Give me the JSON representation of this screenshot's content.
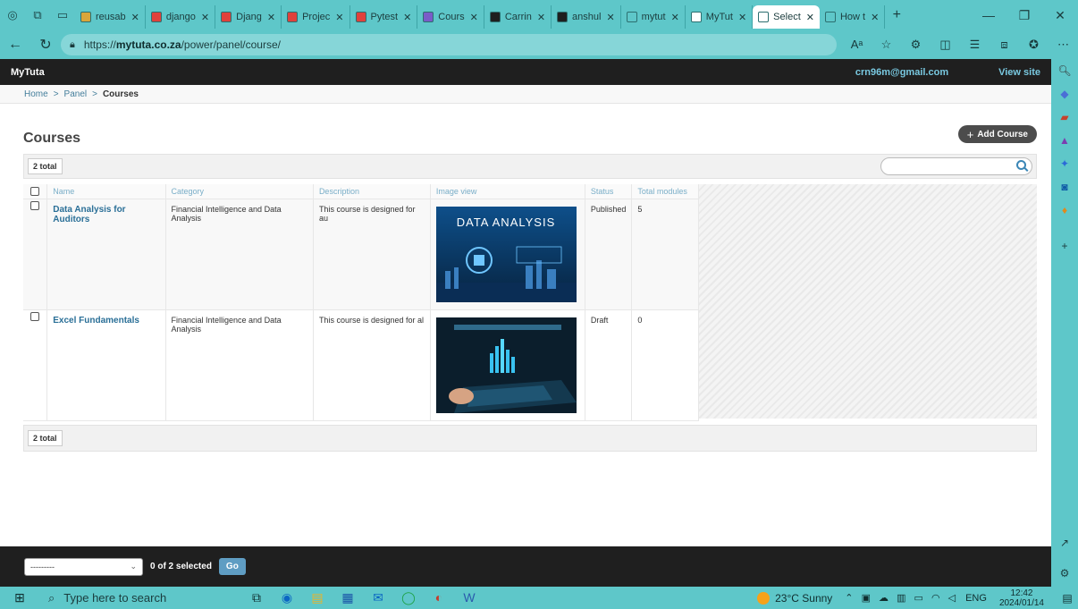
{
  "browser": {
    "tabs": [
      {
        "label": "reusab",
        "color": "#d9a63a"
      },
      {
        "label": "django",
        "color": "#e0413b"
      },
      {
        "label": "Djang",
        "color": "#e0413b"
      },
      {
        "label": "Projec",
        "color": "#e0413b"
      },
      {
        "label": "Pytest",
        "color": "#e0413b"
      },
      {
        "label": "Cours",
        "color": "#7a5cc8"
      },
      {
        "label": "Carrin",
        "color": "#1f1f1f"
      },
      {
        "label": "anshul",
        "color": "#1f1f1f"
      },
      {
        "label": "mytut",
        "color": "#5ec7c9"
      },
      {
        "label": "MyTut",
        "color": "#ffffff"
      },
      {
        "label": "Select",
        "color": "#ffffff"
      },
      {
        "label": "How t",
        "color": "#5ec7c9"
      }
    ],
    "url_prefix": "https://",
    "url_host": "mytuta.co.za",
    "url_path": "/power/panel/course/"
  },
  "admin": {
    "brand": "MyTuta",
    "user_email": "crn96m@gmail.com",
    "view_site": "View site"
  },
  "breadcrumb": {
    "home": "Home",
    "panel": "Panel",
    "current": "Courses",
    "sep": ">"
  },
  "page": {
    "title": "Courses",
    "add_button": "Add Course",
    "total_label": "2 total",
    "search_placeholder": ""
  },
  "table": {
    "columns": [
      "Name",
      "Category",
      "Description",
      "Image view",
      "Status",
      "Total modules"
    ],
    "rows": [
      {
        "name": "Data Analysis for Auditors",
        "category": "Financial Intelligence and Data Analysis",
        "description": "This course is designed for au",
        "image_caption": "DATA ANALYSIS",
        "status": "Published",
        "modules": "5"
      },
      {
        "name": "Excel Fundamentals",
        "category": "Financial Intelligence and Data Analysis",
        "description": "This course is designed for al",
        "image_caption": "",
        "status": "Draft",
        "modules": "0"
      }
    ]
  },
  "actions": {
    "select_value": "---------",
    "selected_count": "0 of 2 selected",
    "go": "Go"
  },
  "taskbar": {
    "search_text": "Type here to search",
    "weather": "23°C Sunny",
    "lang": "ENG",
    "time": "12:42",
    "date": "2024/01/14"
  },
  "colors": {
    "browser_teal": "#5ec7c9",
    "admin_dark": "#1f1f1f",
    "link_blue": "#2a6f97",
    "go_blue": "#5f9dc3"
  }
}
